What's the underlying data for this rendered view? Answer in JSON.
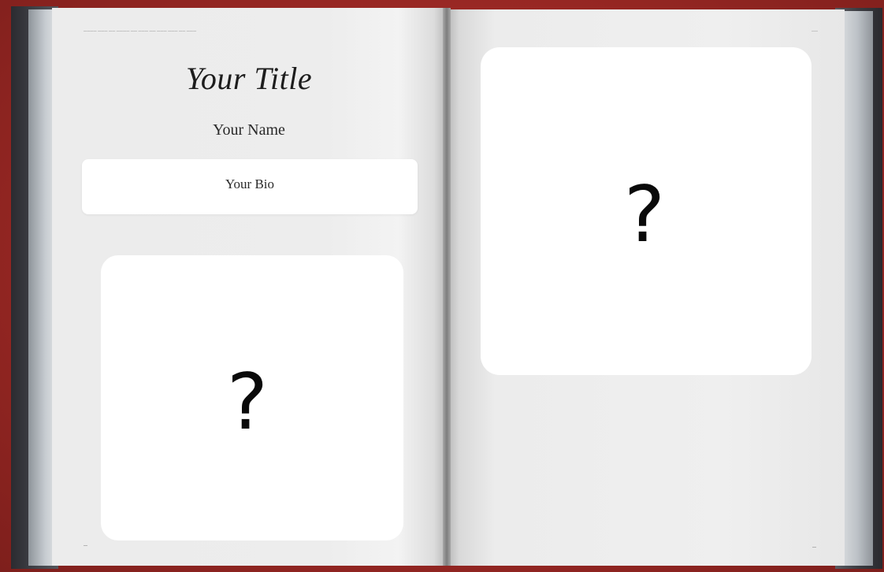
{
  "book": {
    "left_page": {
      "running_head": "———— ——— —— ———— —— ——— —— ——— ——— —— ———",
      "title": "Your Title",
      "author": "Your Name",
      "bio": "Your Bio",
      "photo_placeholder": "?",
      "folio": "—"
    },
    "right_page": {
      "running_head": "——",
      "photo_placeholder": "?",
      "folio": "—"
    }
  },
  "colors": {
    "background": "#9c2a26",
    "page": "#ededed",
    "card": "#ffffff",
    "ink": "#1d1d1d"
  },
  "icons": [
    "question-mark-icon"
  ]
}
